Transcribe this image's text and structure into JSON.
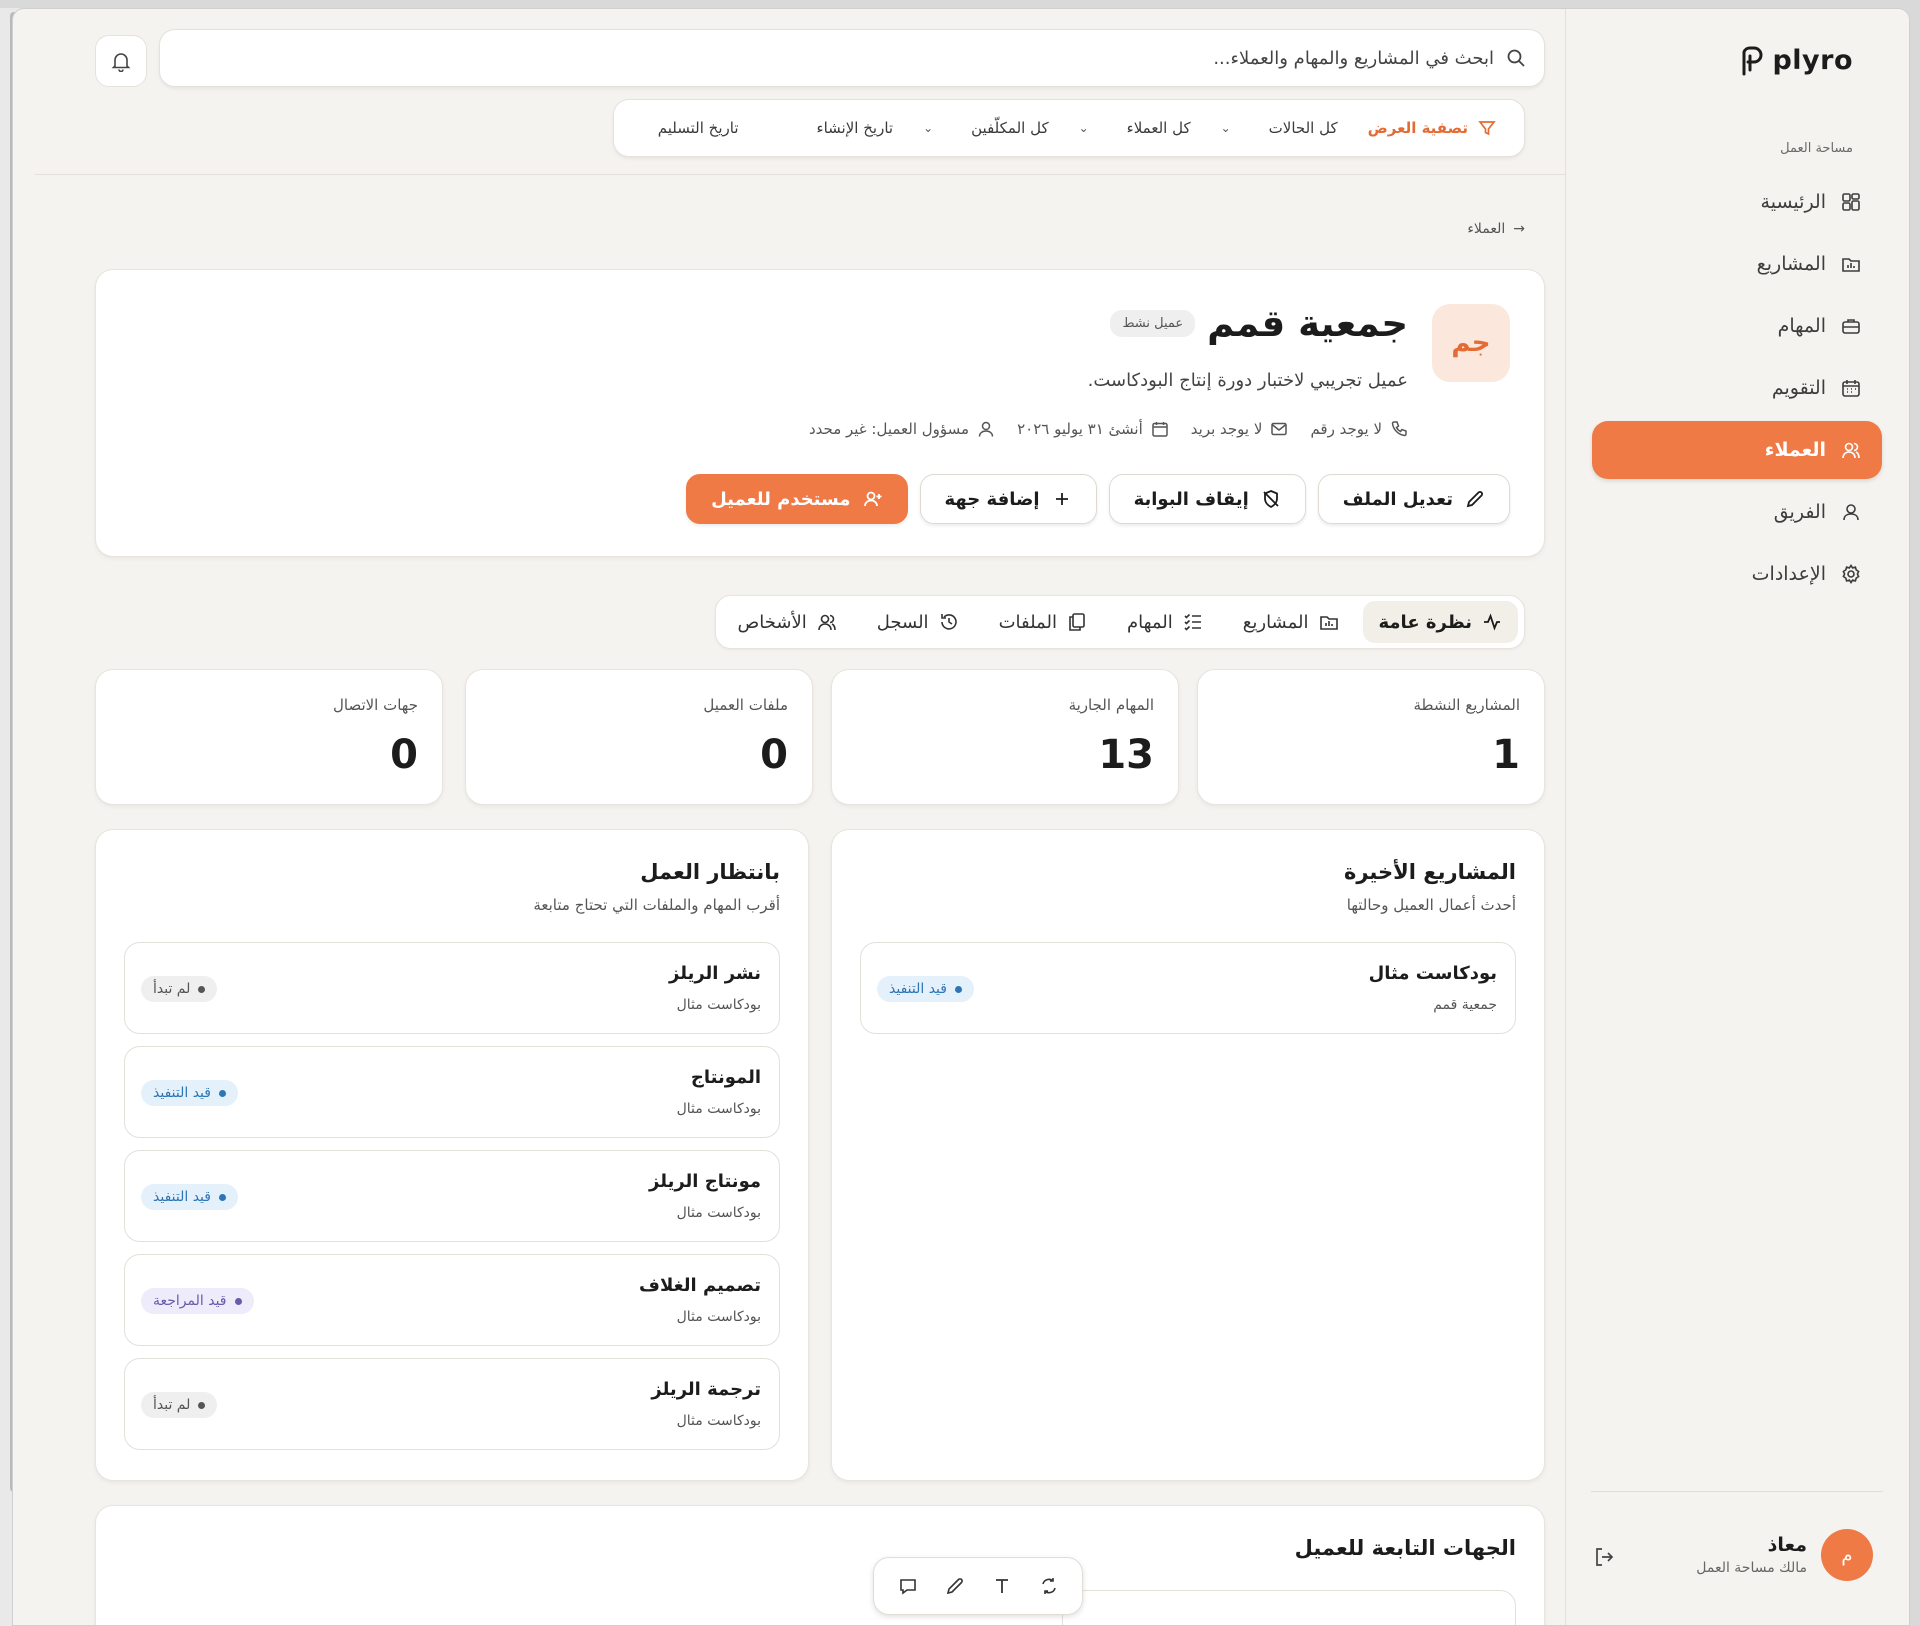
{
  "brand": {
    "name": "plyro"
  },
  "sidebar": {
    "workspace_label": "مساحة العمل",
    "items": [
      {
        "label": "الرئيسية",
        "icon": "grid-icon"
      },
      {
        "label": "المشاريع",
        "icon": "folder-icon"
      },
      {
        "label": "المهام",
        "icon": "briefcase-icon"
      },
      {
        "label": "التقويم",
        "icon": "calendar-icon"
      },
      {
        "label": "العملاء",
        "icon": "users-icon",
        "active": true
      },
      {
        "label": "الفريق",
        "icon": "user-icon"
      },
      {
        "label": "الإعدادات",
        "icon": "gear-icon"
      }
    ],
    "user": {
      "avatar_letter": "م",
      "name": "معاذ",
      "role": "مالك مساحة العمل"
    }
  },
  "search": {
    "placeholder": "ابحث في المشاريع والمهام والعملاء..."
  },
  "filters": {
    "title": "تصفية العرض",
    "status": "كل الحالات",
    "clients": "كل العملاء",
    "assignees": "كل المكلّفين",
    "created": "تاريخ الإنشاء",
    "due": "تاريخ التسليم"
  },
  "breadcrumb": {
    "label": "العملاء"
  },
  "client": {
    "initials": "جم",
    "name": "جمعية قمم",
    "status_badge": "عميل نشط",
    "description": "عميل تجريبي لاختبار دورة إنتاج البودكاست.",
    "phone": "لا يوجد رقم",
    "email": "لا يوجد بريد",
    "created": "أنشئ ٣١ يوليو ٢٠٢٦",
    "owner": "مسؤول العميل: غير محدد"
  },
  "actions": {
    "edit": "تعديل الملف",
    "stop_portal": "إيقاف البوابة",
    "add_contact": "إضافة جهة",
    "client_user": "مستخدم للعميل"
  },
  "tabs": [
    "نظرة عامة",
    "المشاريع",
    "المهام",
    "الملفات",
    "السجل",
    "الأشخاص"
  ],
  "stats": [
    {
      "label": "المشاريع النشطة",
      "value": "1"
    },
    {
      "label": "المهام الجارية",
      "value": "13"
    },
    {
      "label": "ملفات العميل",
      "value": "0"
    },
    {
      "label": "جهات الاتصال",
      "value": "0"
    }
  ],
  "recent_projects": {
    "title": "المشاريع الأخيرة",
    "subtitle": "أحدث أعمال العميل وحالتها",
    "items": [
      {
        "title": "بودكاست مثال",
        "sub": "جمعية قمم",
        "status": "قيد التنفيذ"
      }
    ]
  },
  "pending": {
    "title": "بانتظار العمل",
    "subtitle": "أقرب المهام والملفات التي تحتاج متابعة",
    "items": [
      {
        "title": "نشر الريلز",
        "sub": "بودكاست مثال",
        "status": "لم تبدأ"
      },
      {
        "title": "المونتاج",
        "sub": "بودكاست مثال",
        "status": "قيد التنفيذ"
      },
      {
        "title": "مونتاج الريلز",
        "sub": "بودكاست مثال",
        "status": "قيد التنفيذ"
      },
      {
        "title": "تصميم الغلاف",
        "sub": "بودكاست مثال",
        "status": "قيد المراجعة"
      },
      {
        "title": "ترجمة الريلز",
        "sub": "بودكاست مثال",
        "status": "لم تبدأ"
      }
    ]
  },
  "affiliates": {
    "title": "الجهات التابعة للعميل"
  },
  "colors": {
    "accent": "#ef7a45",
    "background": "#f5f3ef",
    "status_blue": "#2c76b8",
    "status_purple": "#6a5aab"
  }
}
